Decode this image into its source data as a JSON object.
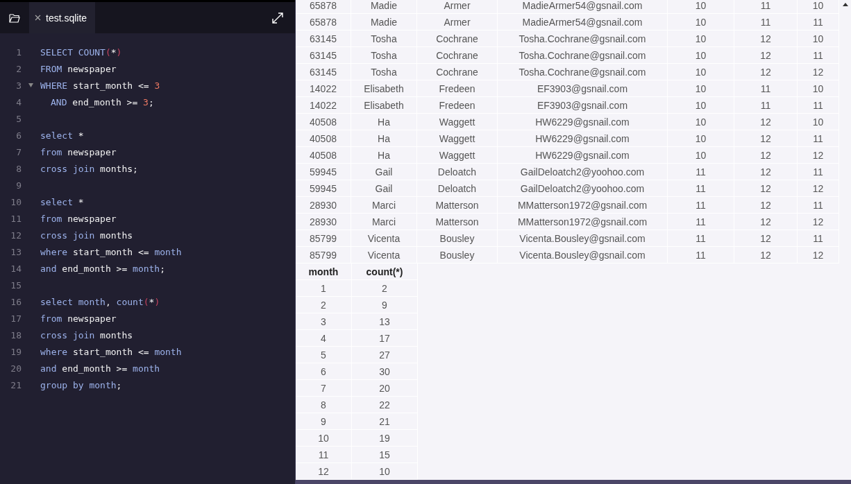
{
  "editor": {
    "tab": {
      "title": "test.sqlite",
      "selected": true
    },
    "lines": [
      {
        "number": "1",
        "tokens": [
          {
            "kind": "keyword",
            "text": "SELECT COUNT"
          },
          {
            "kind": "paren",
            "text": "("
          },
          {
            "kind": "plain",
            "text": "*"
          },
          {
            "kind": "paren",
            "text": ")"
          }
        ]
      },
      {
        "number": "2",
        "tokens": [
          {
            "kind": "keyword",
            "text": "FROM"
          },
          {
            "kind": "plain",
            "text": " newspaper"
          }
        ]
      },
      {
        "number": "3",
        "fold_marker": true,
        "tokens": [
          {
            "kind": "keyword",
            "text": "WHERE"
          },
          {
            "kind": "plain",
            "text": " start_month <= "
          },
          {
            "kind": "number",
            "text": "3"
          }
        ]
      },
      {
        "number": "4",
        "indent": true,
        "tokens": [
          {
            "kind": "keyword",
            "text": "AND"
          },
          {
            "kind": "plain",
            "text": " end_month >= "
          },
          {
            "kind": "number",
            "text": "3"
          },
          {
            "kind": "plain",
            "text": ";"
          }
        ]
      },
      {
        "number": "5"
      },
      {
        "number": "6",
        "tokens": [
          {
            "kind": "keyword",
            "text": "select"
          },
          {
            "kind": "plain",
            "text": " *"
          }
        ]
      },
      {
        "number": "7",
        "tokens": [
          {
            "kind": "keyword",
            "text": "from"
          },
          {
            "kind": "plain",
            "text": " newspaper"
          }
        ]
      },
      {
        "number": "8",
        "tokens": [
          {
            "kind": "keyword",
            "text": "cross join"
          },
          {
            "kind": "plain",
            "text": " months;"
          }
        ]
      },
      {
        "number": "9"
      },
      {
        "number": "10",
        "tokens": [
          {
            "kind": "keyword",
            "text": "select"
          },
          {
            "kind": "plain",
            "text": " *"
          }
        ]
      },
      {
        "number": "11",
        "tokens": [
          {
            "kind": "keyword",
            "text": "from"
          },
          {
            "kind": "plain",
            "text": " newspaper"
          }
        ]
      },
      {
        "number": "12",
        "tokens": [
          {
            "kind": "keyword",
            "text": "cross join"
          },
          {
            "kind": "plain",
            "text": " months"
          }
        ]
      },
      {
        "number": "13",
        "tokens": [
          {
            "kind": "keyword",
            "text": "where"
          },
          {
            "kind": "plain",
            "text": " start_month <= "
          },
          {
            "kind": "keyword",
            "text": "month"
          }
        ]
      },
      {
        "number": "14",
        "tokens": [
          {
            "kind": "keyword",
            "text": "and"
          },
          {
            "kind": "plain",
            "text": " end_month >= "
          },
          {
            "kind": "keyword",
            "text": "month"
          },
          {
            "kind": "plain",
            "text": ";"
          }
        ]
      },
      {
        "number": "15"
      },
      {
        "number": "16",
        "tokens": [
          {
            "kind": "keyword",
            "text": "select month"
          },
          {
            "kind": "plain",
            "text": ", "
          },
          {
            "kind": "keyword",
            "text": "count"
          },
          {
            "kind": "paren",
            "text": "("
          },
          {
            "kind": "plain",
            "text": "*"
          },
          {
            "kind": "paren",
            "text": ")"
          }
        ]
      },
      {
        "number": "17",
        "tokens": [
          {
            "kind": "keyword",
            "text": "from"
          },
          {
            "kind": "plain",
            "text": " newspaper"
          }
        ]
      },
      {
        "number": "18",
        "tokens": [
          {
            "kind": "keyword",
            "text": "cross join"
          },
          {
            "kind": "plain",
            "text": " months"
          }
        ]
      },
      {
        "number": "19",
        "tokens": [
          {
            "kind": "keyword",
            "text": "where"
          },
          {
            "kind": "plain",
            "text": " start_month <= "
          },
          {
            "kind": "keyword",
            "text": "month"
          }
        ]
      },
      {
        "number": "20",
        "tokens": [
          {
            "kind": "keyword",
            "text": "and"
          },
          {
            "kind": "plain",
            "text": " end_month >= "
          },
          {
            "kind": "keyword",
            "text": "month"
          }
        ]
      },
      {
        "number": "21",
        "tokens": [
          {
            "kind": "keyword",
            "text": "group by month"
          },
          {
            "kind": "plain",
            "text": ";"
          }
        ]
      }
    ]
  },
  "results": {
    "table_1": {
      "rows": [
        [
          "65878",
          "Madie",
          "Armer",
          "MadieArmer54@gsnail.com",
          "10",
          "11",
          "10"
        ],
        [
          "65878",
          "Madie",
          "Armer",
          "MadieArmer54@gsnail.com",
          "10",
          "11",
          "11"
        ],
        [
          "63145",
          "Tosha",
          "Cochrane",
          "Tosha.Cochrane@gsnail.com",
          "10",
          "12",
          "10"
        ],
        [
          "63145",
          "Tosha",
          "Cochrane",
          "Tosha.Cochrane@gsnail.com",
          "10",
          "12",
          "11"
        ],
        [
          "63145",
          "Tosha",
          "Cochrane",
          "Tosha.Cochrane@gsnail.com",
          "10",
          "12",
          "12"
        ],
        [
          "14022",
          "Elisabeth",
          "Fredeen",
          "EF3903@gsnail.com",
          "10",
          "11",
          "10"
        ],
        [
          "14022",
          "Elisabeth",
          "Fredeen",
          "EF3903@gsnail.com",
          "10",
          "11",
          "11"
        ],
        [
          "40508",
          "Ha",
          "Waggett",
          "HW6229@gsnail.com",
          "10",
          "12",
          "10"
        ],
        [
          "40508",
          "Ha",
          "Waggett",
          "HW6229@gsnail.com",
          "10",
          "12",
          "11"
        ],
        [
          "40508",
          "Ha",
          "Waggett",
          "HW6229@gsnail.com",
          "10",
          "12",
          "12"
        ],
        [
          "59945",
          "Gail",
          "Deloatch",
          "GailDeloatch2@yoohoo.com",
          "11",
          "12",
          "11"
        ],
        [
          "59945",
          "Gail",
          "Deloatch",
          "GailDeloatch2@yoohoo.com",
          "11",
          "12",
          "12"
        ],
        [
          "28930",
          "Marci",
          "Matterson",
          "MMatterson1972@gsnail.com",
          "11",
          "12",
          "11"
        ],
        [
          "28930",
          "Marci",
          "Matterson",
          "MMatterson1972@gsnail.com",
          "11",
          "12",
          "12"
        ],
        [
          "85799",
          "Vicenta",
          "Bousley",
          "Vicenta.Bousley@gsnail.com",
          "11",
          "12",
          "11"
        ],
        [
          "85799",
          "Vicenta",
          "Bousley",
          "Vicenta.Bousley@gsnail.com",
          "11",
          "12",
          "12"
        ]
      ]
    },
    "table_2": {
      "columns": [
        "month",
        "count(*)"
      ],
      "rows": [
        [
          "1",
          "2"
        ],
        [
          "2",
          "9"
        ],
        [
          "3",
          "13"
        ],
        [
          "4",
          "17"
        ],
        [
          "5",
          "27"
        ],
        [
          "6",
          "30"
        ],
        [
          "7",
          "20"
        ],
        [
          "8",
          "22"
        ],
        [
          "9",
          "21"
        ],
        [
          "10",
          "19"
        ],
        [
          "11",
          "15"
        ],
        [
          "12",
          "10"
        ]
      ]
    }
  }
}
